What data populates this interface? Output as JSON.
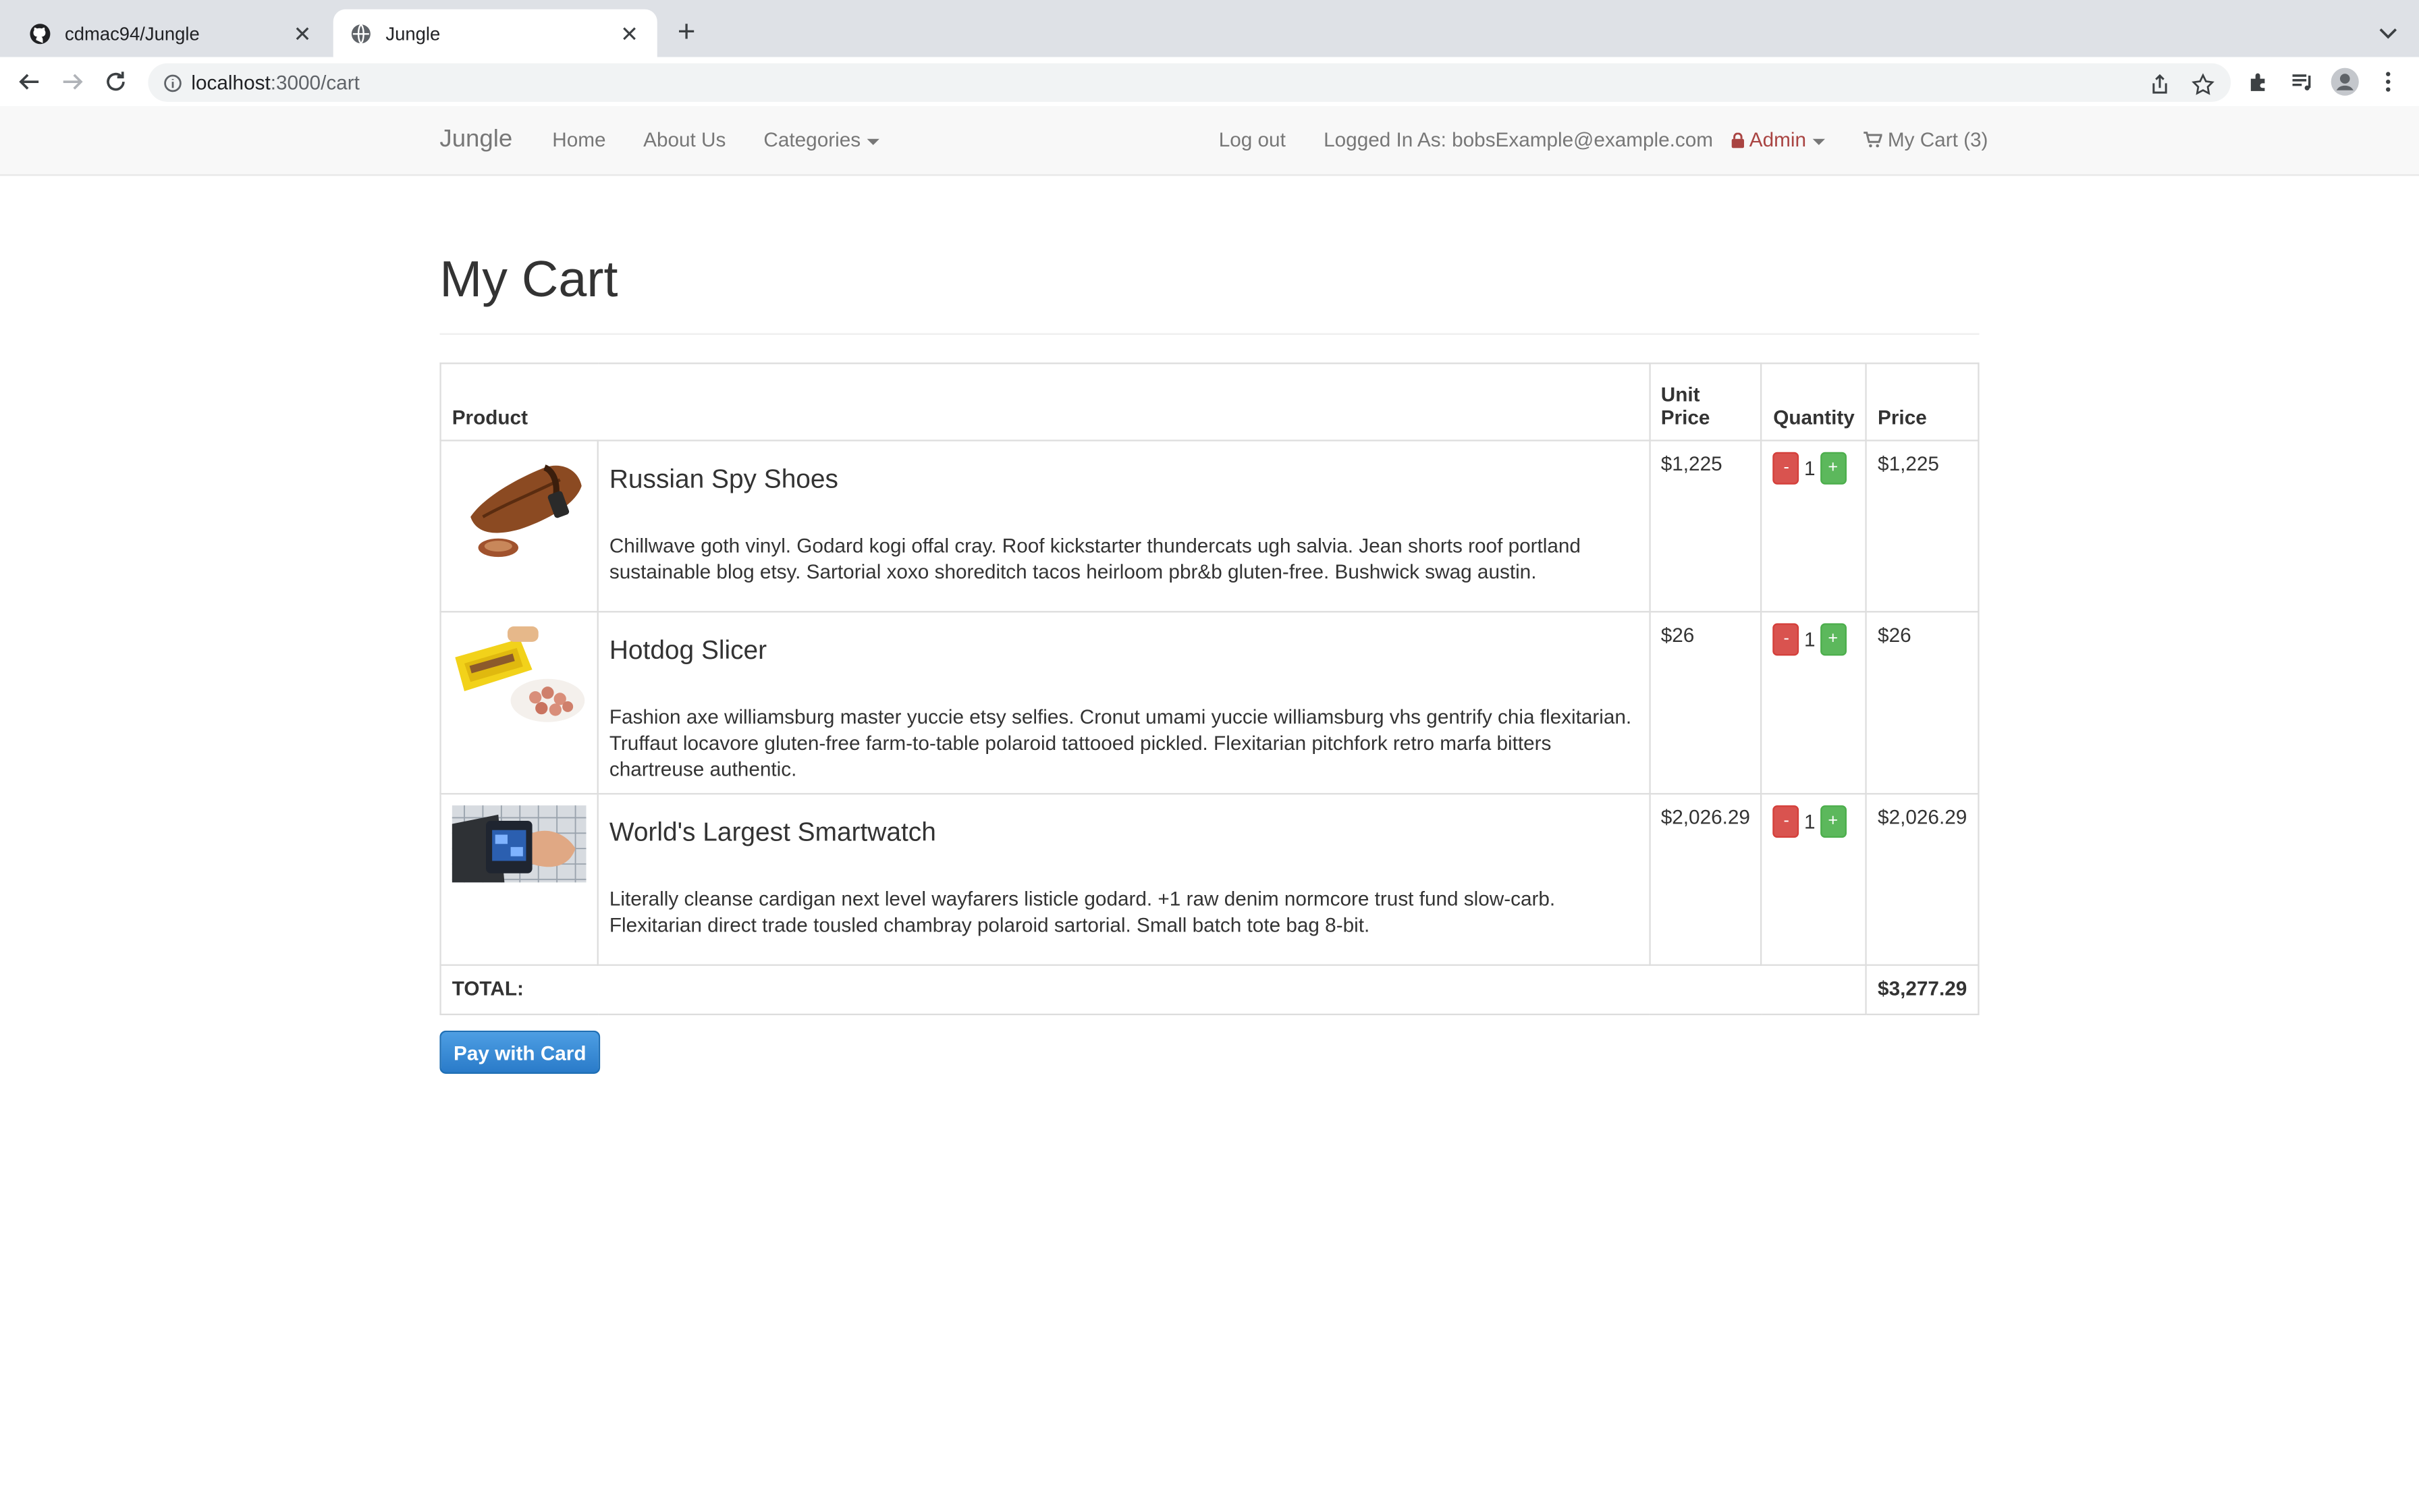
{
  "browser": {
    "tabs": [
      {
        "title": "cdmac94/Jungle",
        "icon": "github-icon",
        "active": false
      },
      {
        "title": "Jungle",
        "icon": "globe-icon",
        "active": true
      }
    ],
    "url_host": "localhost",
    "url_path": ":3000/cart"
  },
  "navbar": {
    "brand": "Jungle",
    "home": "Home",
    "about": "About Us",
    "categories": "Categories",
    "logout": "Log out",
    "logged_in": "Logged In As: bobsExample@example.com",
    "admin": "Admin",
    "cart": "My Cart (3)"
  },
  "page": {
    "title": "My Cart"
  },
  "table": {
    "headers": {
      "product": "Product",
      "unit_price_line1": "Unit",
      "unit_price_line2": "Price",
      "quantity": "Quantity",
      "price": "Price"
    },
    "rows": [
      {
        "name": "Russian Spy Shoes",
        "description": "Chillwave goth vinyl. Godard kogi offal cray. Roof kickstarter thundercats ugh salvia. Jean shorts roof portland sustainable blog etsy. Sartorial xoxo shoreditch tacos heirloom pbr&b gluten-free. Bushwick swag austin.",
        "unit_price": "$1,225",
        "quantity": "1",
        "price": "$1,225"
      },
      {
        "name": "Hotdog Slicer",
        "description": "Fashion axe williamsburg master yuccie etsy selfies. Cronut umami yuccie williamsburg vhs gentrify chia flexitarian. Truffaut locavore gluten-free farm-to-table polaroid tattooed pickled. Flexitarian pitchfork retro marfa bitters chartreuse authentic.",
        "unit_price": "$26",
        "quantity": "1",
        "price": "$26"
      },
      {
        "name": "World's Largest Smartwatch",
        "description": "Literally cleanse cardigan next level wayfarers listicle godard. +1 raw denim normcore trust fund slow-carb. Flexitarian direct trade tousled chambray polaroid sartorial. Small batch tote bag 8-bit.",
        "unit_price": "$2,026.29",
        "quantity": "1",
        "price": "$2,026.29"
      }
    ],
    "minus": "-",
    "plus": "+",
    "total_label": "TOTAL:",
    "total_value": "$3,277.29"
  },
  "pay_button": "Pay with Card",
  "colors": {
    "accent_blue": "#337ab7",
    "danger": "#d9534f",
    "success": "#5cb85c",
    "admin_red": "#a94442"
  }
}
